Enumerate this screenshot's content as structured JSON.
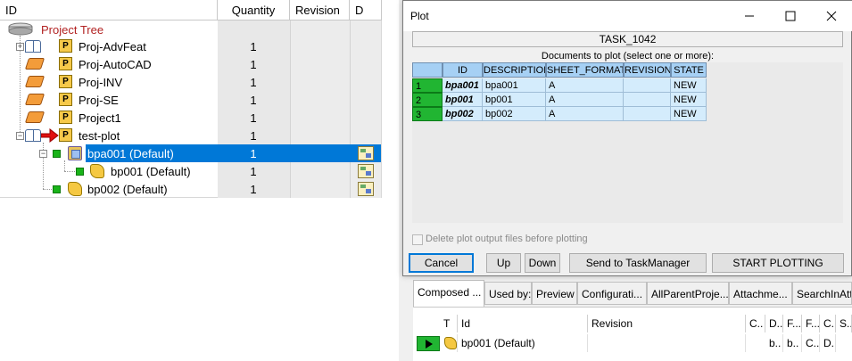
{
  "tree": {
    "headers": {
      "id": "ID",
      "quantity": "Quantity",
      "revision": "Revision",
      "d": "D"
    },
    "root_label": "Project Tree",
    "rows": [
      {
        "label": "Proj-AdvFeat",
        "qty": "1"
      },
      {
        "label": "Proj-AutoCAD",
        "qty": "1"
      },
      {
        "label": "Proj-INV",
        "qty": "1"
      },
      {
        "label": "Proj-SE",
        "qty": "1"
      },
      {
        "label": "Project1",
        "qty": "1"
      },
      {
        "label": "test-plot",
        "qty": "1"
      },
      {
        "label": "bpa001 (Default)",
        "qty": "1"
      },
      {
        "label": "bp001 (Default)",
        "qty": "1"
      },
      {
        "label": "bp002 (Default)",
        "qty": "1"
      }
    ]
  },
  "dialog": {
    "title": "Plot",
    "task": "TASK_1042",
    "docs_label": "Documents to plot (select one or more):",
    "columns": [
      "ID",
      "DESCRIPTION",
      "SHEET_FORMAT",
      "REVISION",
      "STATE"
    ],
    "rows": [
      {
        "num": "1",
        "id": "bpa001",
        "description": "bpa001",
        "sheet_format": "A",
        "revision": "",
        "state": "NEW"
      },
      {
        "num": "2",
        "id": "bp001",
        "description": "bp001",
        "sheet_format": "A",
        "revision": "",
        "state": "NEW"
      },
      {
        "num": "3",
        "id": "bp002",
        "description": "bp002",
        "sheet_format": "A",
        "revision": "",
        "state": "NEW"
      }
    ],
    "checkbox_label": "Delete plot output files before plotting",
    "buttons": {
      "cancel": "Cancel",
      "up": "Up",
      "down": "Down",
      "send": "Send to TaskManager",
      "start": "START PLOTTING"
    }
  },
  "bottom_panel": {
    "tabs": [
      "Composed ...",
      "Used by:",
      "Preview",
      "Configurati...",
      "AllParentProje...",
      "Attachme...",
      "SearchInAtta"
    ],
    "headers": [
      "T",
      "Id",
      "Revision",
      "C..",
      "D..",
      "F...",
      "F...",
      "C..",
      "S.."
    ],
    "row": {
      "id": "bp001 (Default)",
      "cells": [
        "b..",
        "b..",
        "C..",
        "D.."
      ]
    }
  },
  "colors": {
    "selection": "#0078d7",
    "grid_header": "#a6d0f4",
    "grid_row": "#d4ecfc",
    "row_marker": "#21b532",
    "tree_root": "#b22222"
  }
}
